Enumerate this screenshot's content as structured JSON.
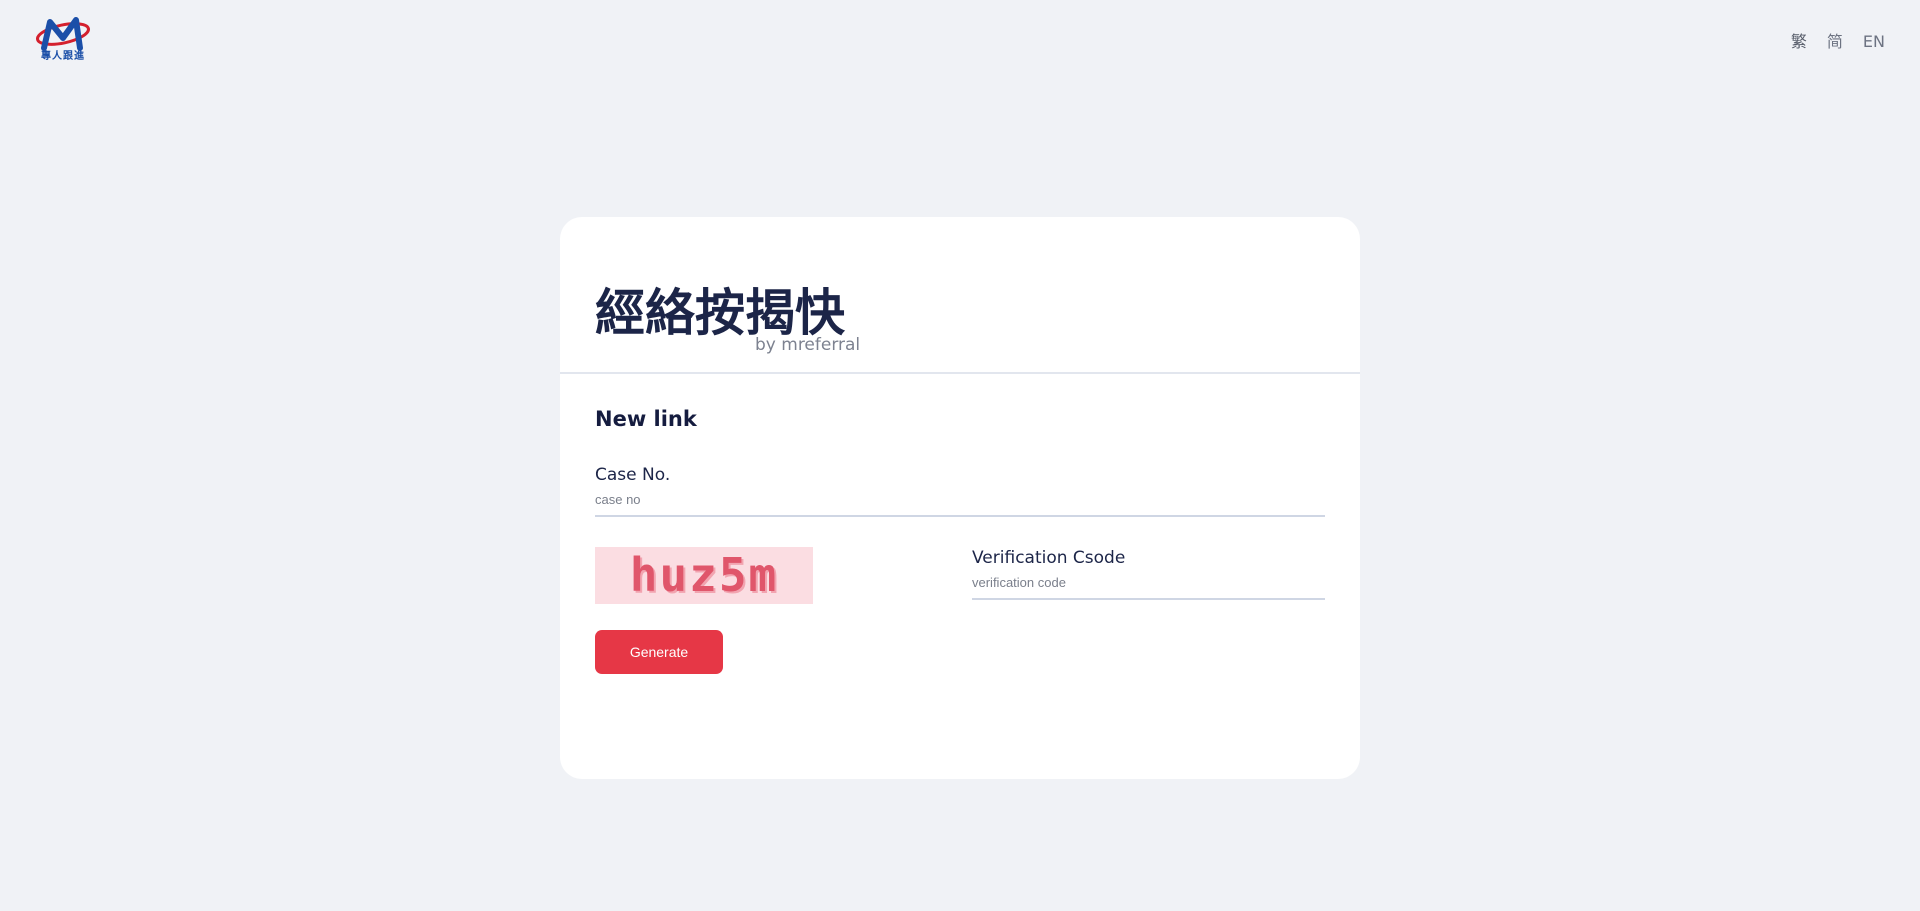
{
  "header": {
    "logo_text": "專人跟進",
    "languages": [
      {
        "label": "繁",
        "active": true
      },
      {
        "label": "简",
        "active": false
      },
      {
        "label": "EN",
        "active": false
      }
    ]
  },
  "brand": {
    "title": "經絡按揭快",
    "subtitle": "by mreferral"
  },
  "form": {
    "section_title": "New link",
    "case_no": {
      "label": "Case No.",
      "placeholder": "case no",
      "value": ""
    },
    "captcha": {
      "text": "huz5m"
    },
    "verification": {
      "label": "Verification Csode",
      "placeholder": "verification code",
      "value": ""
    },
    "generate_label": "Generate"
  },
  "colors": {
    "background": "#f0f2f6",
    "card": "#ffffff",
    "primary_button": "#e63746",
    "heading": "#1c2548",
    "captcha_bg": "#fbdde2",
    "captcha_text": "#e0566b"
  }
}
